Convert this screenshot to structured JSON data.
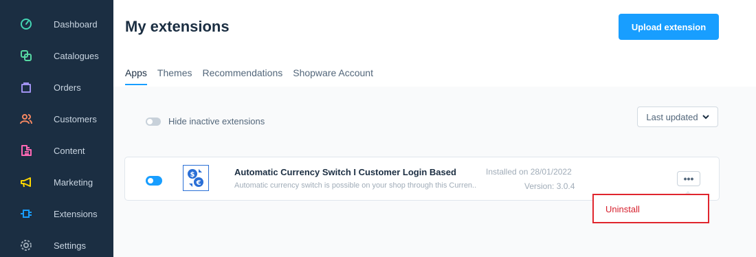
{
  "sidebar": {
    "items": [
      {
        "label": "Dashboard",
        "icon": "dashboard-gauge-icon",
        "color": "#44d6b4"
      },
      {
        "label": "Catalogues",
        "icon": "catalogue-icon",
        "color": "#57d9a3"
      },
      {
        "label": "Orders",
        "icon": "orders-bag-icon",
        "color": "#a092f0"
      },
      {
        "label": "Customers",
        "icon": "customers-icon",
        "color": "#f88962"
      },
      {
        "label": "Content",
        "icon": "content-icon",
        "color": "#ff68b4"
      },
      {
        "label": "Marketing",
        "icon": "marketing-megaphone-icon",
        "color": "#ffd700"
      },
      {
        "label": "Extensions",
        "icon": "extensions-plug-icon",
        "color": "#189eff"
      },
      {
        "label": "Settings",
        "icon": "settings-gear-icon",
        "color": "#9aa8b5"
      }
    ]
  },
  "header": {
    "title": "My extensions",
    "upload_label": "Upload extension"
  },
  "tabs": [
    {
      "label": "Apps",
      "active": true
    },
    {
      "label": "Themes",
      "active": false
    },
    {
      "label": "Recommendations",
      "active": false
    },
    {
      "label": "Shopware Account",
      "active": false
    }
  ],
  "filter": {
    "hide_inactive_label": "Hide inactive extensions",
    "sort_label": "Last updated"
  },
  "extension": {
    "name": "Automatic Currency Switch I Customer Login Based",
    "description": "Automatic currency switch is possible on your shop through this Curren...",
    "installed": "Installed on 28/01/2022",
    "version": "Version: 3.0.4",
    "active": true
  },
  "context_menu": {
    "uninstall_label": "Uninstall"
  }
}
